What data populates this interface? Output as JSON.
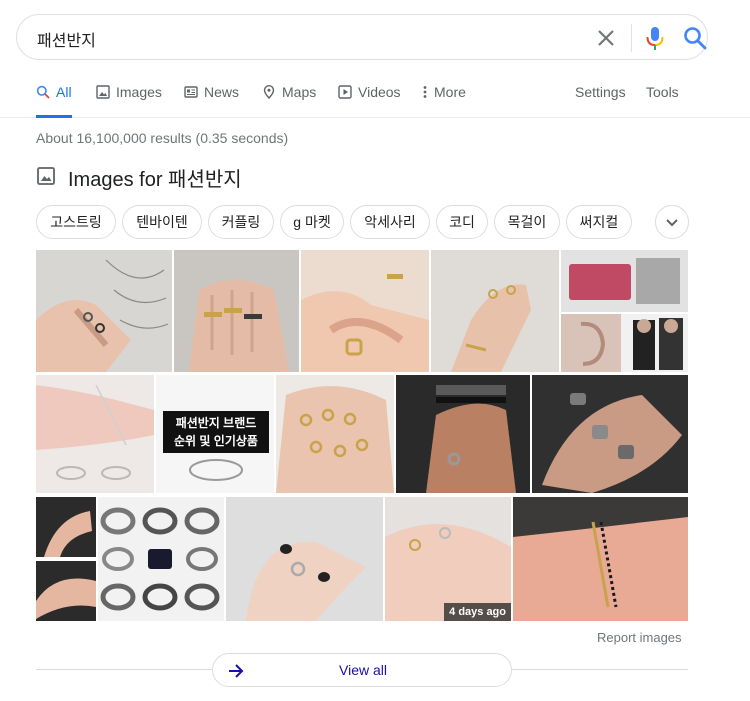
{
  "search": {
    "query": "패션반지"
  },
  "tabs": [
    {
      "label": "All",
      "icon": "search-icon",
      "active": true
    },
    {
      "label": "Images",
      "icon": "image-icon"
    },
    {
      "label": "News",
      "icon": "news-icon"
    },
    {
      "label": "Maps",
      "icon": "map-pin-icon"
    },
    {
      "label": "Videos",
      "icon": "play-icon"
    },
    {
      "label": "More",
      "icon": "more-vert-icon"
    }
  ],
  "tools": {
    "settings": "Settings",
    "tools": "Tools"
  },
  "results_stats": "About 16,100,000 results (0.35 seconds)",
  "images_section": {
    "heading": "Images for 패션반지",
    "chips": [
      "고스트링",
      "텐바이텐",
      "커플링",
      "g 마켓",
      "악세사리",
      "코디",
      "목걸이",
      "써지컬"
    ],
    "brand_overlay": [
      "패션반지 브랜드",
      "순위 및 인기상품"
    ],
    "time_badge": "4 days ago",
    "report_label": "Report images",
    "view_all_label": "View all"
  },
  "colors": {
    "accent": "#1a73e8",
    "link": "#1a0dab",
    "muted": "#70757a"
  }
}
